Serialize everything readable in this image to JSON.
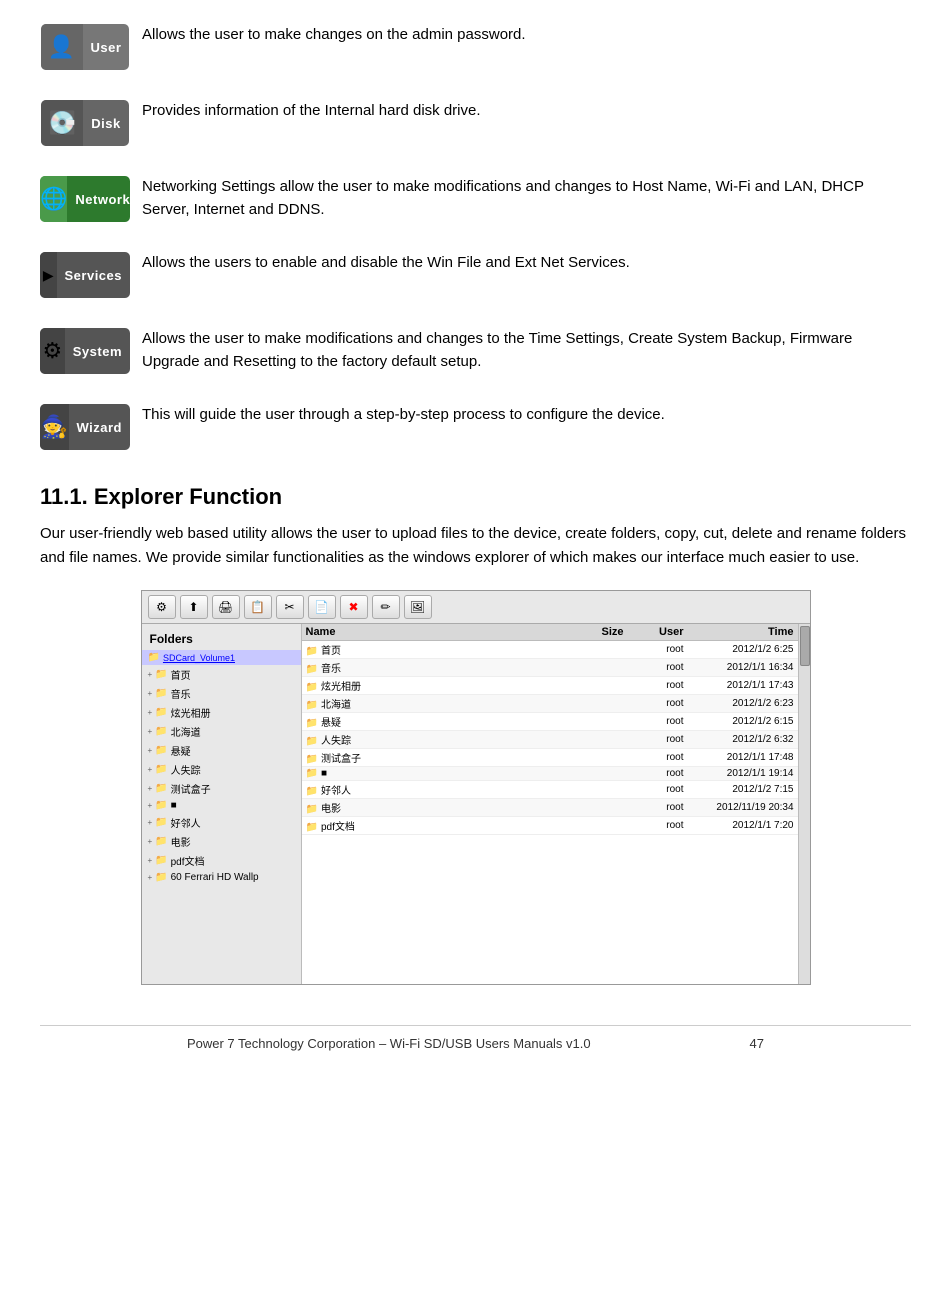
{
  "sections": [
    {
      "id": "user",
      "icon_emoji": "👤",
      "badge_label": "User",
      "badge_class": "rb-user",
      "text": "Allows the user to make changes on the admin password."
    },
    {
      "id": "disk",
      "icon_emoji": "💽",
      "badge_label": "Disk",
      "badge_class": "rb-disk",
      "text": "Provides information of the Internal hard disk drive."
    },
    {
      "id": "network",
      "icon_emoji": "🌐",
      "badge_label": "Network",
      "badge_class": "rb-network",
      "text": "Networking Settings allow the user to make modifications and changes to Host Name, Wi-Fi and LAN, DHCP Server, Internet and DDNS."
    },
    {
      "id": "services",
      "icon_emoji": "▶",
      "badge_label": "Services",
      "badge_class": "rb-services",
      "text": "Allows the users to enable and disable the Win File and Ext Net Services."
    },
    {
      "id": "system",
      "icon_emoji": "⚙",
      "badge_label": "System",
      "badge_class": "rb-system",
      "text": "Allows the user to make modifications and changes to the Time Settings, Create System Backup, Firmware Upgrade and Resetting to the factory default setup."
    },
    {
      "id": "wizard",
      "icon_emoji": "🧙",
      "badge_label": "Wizard",
      "badge_class": "rb-wizard",
      "text": "This will guide the user through a step-by-step process to configure the device."
    }
  ],
  "explorer": {
    "heading": "11.1. Explorer Function",
    "description": "Our user-friendly web based utility allows the user to upload files to the device, create folders, copy, cut, delete and rename folders and file names.   We provide similar functionalities as the windows explorer of which makes our interface much easier to use.",
    "fm": {
      "folders_title": "Folders",
      "root_label": "SDCard_Volume1",
      "folders": [
        "首页",
        "音乐",
        "炫光相册",
        "北海道",
        "悬疑",
        "人失踪",
        "测试盒子",
        "■",
        "好邻人",
        "电影",
        "pdf文档",
        "60 Ferrari HD Wallp"
      ],
      "header": {
        "name": "Name",
        "size": "Size",
        "user": "User",
        "time": "Time"
      },
      "files": [
        {
          "name": "首页",
          "size": "",
          "user": "root",
          "time": "2012/1/2 6:25"
        },
        {
          "name": "音乐",
          "size": "",
          "user": "root",
          "time": "2012/1/1 16:34"
        },
        {
          "name": "炫光相册",
          "size": "",
          "user": "root",
          "time": "2012/1/1 17:43"
        },
        {
          "name": "北海道",
          "size": "",
          "user": "root",
          "time": "2012/1/2 6:23"
        },
        {
          "name": "悬疑",
          "size": "",
          "user": "root",
          "time": "2012/1/2 6:15"
        },
        {
          "name": "人失踪",
          "size": "",
          "user": "root",
          "time": "2012/1/2 6:32"
        },
        {
          "name": "测试盒子",
          "size": "",
          "user": "root",
          "time": "2012/1/1 17:48"
        },
        {
          "name": "■",
          "size": "",
          "user": "root",
          "time": "2012/1/1 19:14"
        },
        {
          "name": "好邻人",
          "size": "",
          "user": "root",
          "time": "2012/1/2 7:15"
        },
        {
          "name": "电影",
          "size": "",
          "user": "root",
          "time": "2012/11/19 20:34"
        },
        {
          "name": "pdf文档",
          "size": "",
          "user": "root",
          "time": "2012/1/1 7:20"
        }
      ]
    }
  },
  "footer": {
    "text": "Power 7 Technology Corporation – Wi-Fi SD/USB Users Manuals v1.0",
    "page": "47"
  }
}
